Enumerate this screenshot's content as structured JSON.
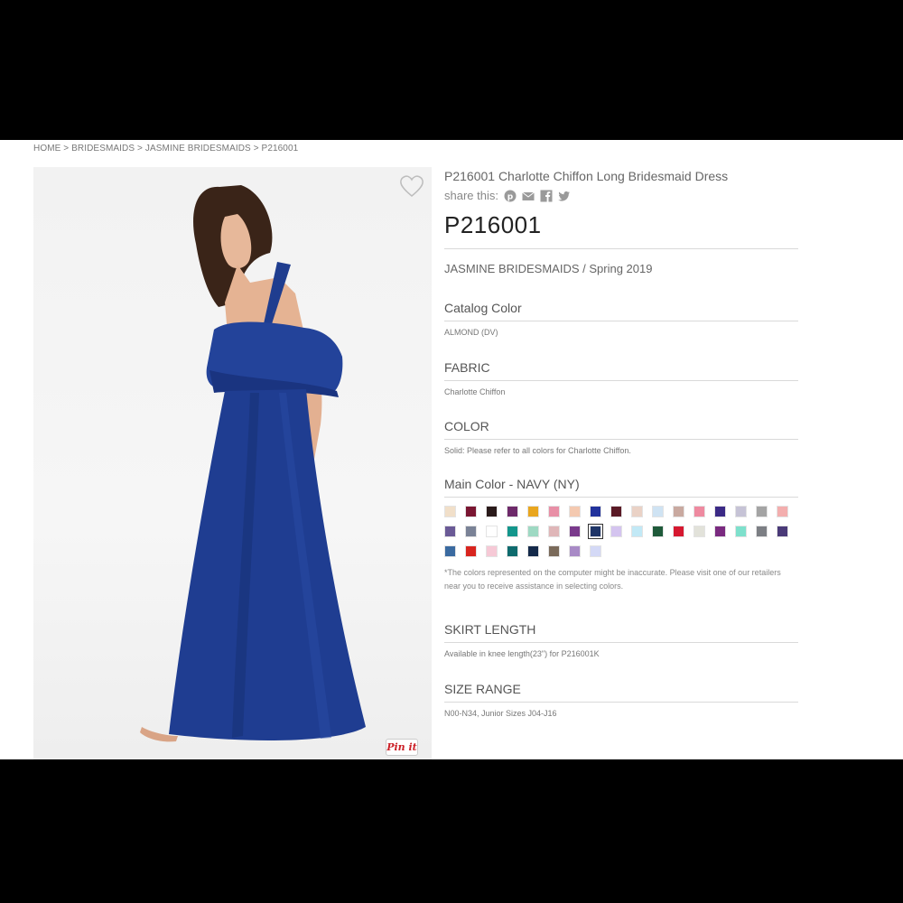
{
  "breadcrumb": {
    "home": "HOME",
    "sep1": ">",
    "bridesmaids": "BRIDESMAIDS",
    "sep2": ">",
    "collection": "JASMINE BRIDESMAIDS",
    "sep3": ">",
    "current": "P216001"
  },
  "product": {
    "title": "P216001 Charlotte Chiffon Long Bridesmaid Dress",
    "share_label": "share this:",
    "sku": "P216001",
    "collection_line": "JASMINE BRIDESMAIDS / Spring 2019"
  },
  "share_icons": [
    "pinterest-icon",
    "email-icon",
    "facebook-icon",
    "twitter-icon"
  ],
  "sections": {
    "catalog_color": {
      "heading": "Catalog Color",
      "value": "ALMOND (DV)"
    },
    "fabric": {
      "heading": "FABRIC",
      "value": "Charlotte Chiffon"
    },
    "color": {
      "heading": "COLOR",
      "value": "Solid: Please refer to all colors for Charlotte Chiffon."
    },
    "main_color": {
      "heading": "Main Color - NAVY (NY)"
    },
    "skirt_length": {
      "heading": "SKIRT LENGTH",
      "value": "Available in knee length(23\") for P216001K"
    },
    "size_range": {
      "heading": "SIZE RANGE",
      "value": "N00-N34, Junior Sizes J04-J16"
    }
  },
  "color_note": "*The colors represented on the computer might be inaccurate. Please visit one of our retailers near you to receive assistance in selecting colors.",
  "swatches": [
    "#f1dfc9",
    "#7a1632",
    "#2a1a1a",
    "#6e2a6a",
    "#e9a61f",
    "#e88fa6",
    "#f4c9b0",
    "#22339c",
    "#5a1a26",
    "#ead2c6",
    "#cfe3f3",
    "#c9a9a0",
    "#ee8aa0",
    "#3b2a86",
    "#c6c3d6",
    "#a4a4a4",
    "#f3aeae",
    "#6a5a96",
    "#7a8296",
    "#ffffff",
    "#13968c",
    "#9ed9c3",
    "#dfb6b8",
    "#7a3a8c",
    "#1f3568",
    "#d4c4ef",
    "#c2e9f6",
    "#1f5a3a",
    "#d61830",
    "#e2e2da",
    "#7a2a80",
    "#7ee0cc",
    "#7c7f84",
    "#4a3a78",
    "#3a6aa0",
    "#d8241e",
    "#f6c9d6",
    "#0e6b6e",
    "#142a4a",
    "#7a6a5a",
    "#a88ac6",
    "#d4d9f6"
  ],
  "selected_swatch_index": 24,
  "pin_label": "Pin it"
}
